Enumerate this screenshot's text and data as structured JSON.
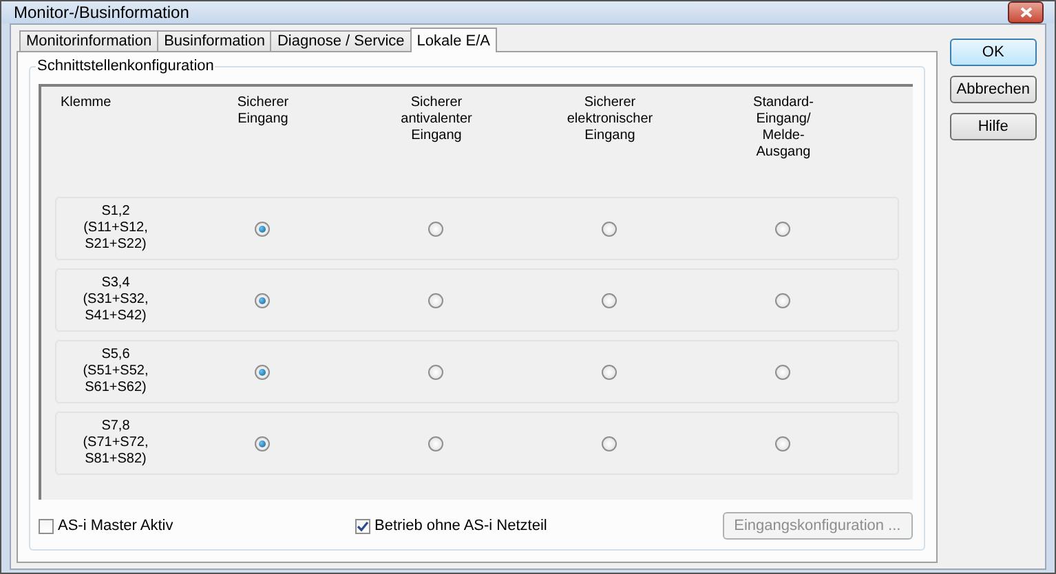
{
  "window": {
    "title": "Monitor-/Businformation"
  },
  "tabs": [
    {
      "label": "Monitorinformation",
      "selected": false
    },
    {
      "label": "Businformation",
      "selected": false
    },
    {
      "label": "Diagnose / Service",
      "selected": false
    },
    {
      "label": "Lokale E/A",
      "selected": true
    }
  ],
  "group": {
    "title": "Schnittstellenkonfiguration"
  },
  "table": {
    "columns": [
      "Klemme",
      "Sicherer\nEingang",
      "Sicherer\nantivalenter\nEingang",
      "Sicherer\nelektronischer\nEingang",
      "Standard-\nEingang/\nMelde-\nAusgang"
    ],
    "rows": [
      {
        "label": "S1,2\n(S11+S12,\nS21+S22)",
        "options": [
          {
            "selected": true
          },
          {
            "selected": false
          },
          {
            "selected": false
          },
          {
            "selected": false
          }
        ]
      },
      {
        "label": "S3,4\n(S31+S32,\nS41+S42)",
        "options": [
          {
            "selected": true
          },
          {
            "selected": false
          },
          {
            "selected": false
          },
          {
            "selected": false
          }
        ]
      },
      {
        "label": "S5,6\n(S51+S52,\nS61+S62)",
        "options": [
          {
            "selected": true
          },
          {
            "selected": false
          },
          {
            "selected": false
          },
          {
            "selected": false
          }
        ]
      },
      {
        "label": "S7,8\n(S71+S72,\nS81+S82)",
        "options": [
          {
            "selected": true
          },
          {
            "selected": false
          },
          {
            "selected": false
          },
          {
            "selected": false
          }
        ]
      }
    ]
  },
  "checkboxes": [
    {
      "label": "AS-i Master Aktiv",
      "checked": false
    },
    {
      "label": "Betrieb ohne AS-i Netzteil",
      "checked": true
    }
  ],
  "config_button": {
    "label": "Eingangskonfiguration ...",
    "disabled": true
  },
  "buttons": [
    {
      "label": "OK",
      "kind": "default"
    },
    {
      "label": "Abbrechen",
      "kind": "normal"
    },
    {
      "label": "Hilfe",
      "kind": "normal"
    }
  ]
}
